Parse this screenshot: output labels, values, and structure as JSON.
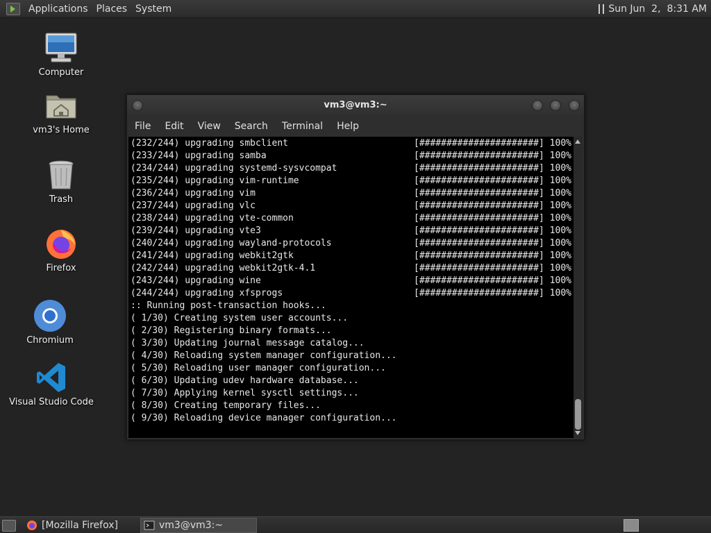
{
  "top_panel": {
    "menus": [
      "Applications",
      "Places",
      "System"
    ],
    "clock": "Sun Jun  2,  8:31 AM"
  },
  "desktop": {
    "icons": [
      {
        "label": "Computer",
        "icon": "computer-icon"
      },
      {
        "label": "vm3's Home",
        "icon": "home-folder-icon"
      },
      {
        "label": "Trash",
        "icon": "trash-icon"
      },
      {
        "label": "Firefox",
        "icon": "firefox-icon"
      },
      {
        "label": "Chromium",
        "icon": "chromium-icon"
      },
      {
        "label": "Visual Studio Code",
        "icon": "vscode-icon"
      }
    ]
  },
  "terminal": {
    "title": "vm3@vm3:~",
    "menu": [
      "File",
      "Edit",
      "View",
      "Search",
      "Terminal",
      "Help"
    ],
    "lines": [
      {
        "text": "(232/244) upgrading smbclient",
        "progress": "[######################] 100%"
      },
      {
        "text": "(233/244) upgrading samba",
        "progress": "[######################] 100%"
      },
      {
        "text": "(234/244) upgrading systemd-sysvcompat",
        "progress": "[######################] 100%"
      },
      {
        "text": "(235/244) upgrading vim-runtime",
        "progress": "[######################] 100%"
      },
      {
        "text": "(236/244) upgrading vim",
        "progress": "[######################] 100%"
      },
      {
        "text": "(237/244) upgrading vlc",
        "progress": "[######################] 100%"
      },
      {
        "text": "(238/244) upgrading vte-common",
        "progress": "[######################] 100%"
      },
      {
        "text": "(239/244) upgrading vte3",
        "progress": "[######################] 100%"
      },
      {
        "text": "(240/244) upgrading wayland-protocols",
        "progress": "[######################] 100%"
      },
      {
        "text": "(241/244) upgrading webkit2gtk",
        "progress": "[######################] 100%"
      },
      {
        "text": "(242/244) upgrading webkit2gtk-4.1",
        "progress": "[######################] 100%"
      },
      {
        "text": "(243/244) upgrading wine",
        "progress": "[######################] 100%"
      },
      {
        "text": "(244/244) upgrading xfsprogs",
        "progress": "[######################] 100%"
      },
      {
        "text": ":: Running post-transaction hooks...",
        "progress": ""
      },
      {
        "text": "( 1/30) Creating system user accounts...",
        "progress": ""
      },
      {
        "text": "( 2/30) Registering binary formats...",
        "progress": ""
      },
      {
        "text": "( 3/30) Updating journal message catalog...",
        "progress": ""
      },
      {
        "text": "( 4/30) Reloading system manager configuration...",
        "progress": ""
      },
      {
        "text": "( 5/30) Reloading user manager configuration...",
        "progress": ""
      },
      {
        "text": "( 6/30) Updating udev hardware database...",
        "progress": ""
      },
      {
        "text": "( 7/30) Applying kernel sysctl settings...",
        "progress": ""
      },
      {
        "text": "( 8/30) Creating temporary files...",
        "progress": ""
      },
      {
        "text": "( 9/30) Reloading device manager configuration...",
        "progress": ""
      }
    ]
  },
  "taskbar": {
    "tasks": [
      {
        "label": "[Mozilla Firefox]",
        "icon": "firefox-icon",
        "active": false
      },
      {
        "label": "vm3@vm3:~",
        "icon": "terminal-icon",
        "active": true
      }
    ]
  },
  "colors": {
    "desktop_bg": "#232323",
    "terminal_bg": "#000000",
    "terminal_fg": "#e8e8e8"
  }
}
